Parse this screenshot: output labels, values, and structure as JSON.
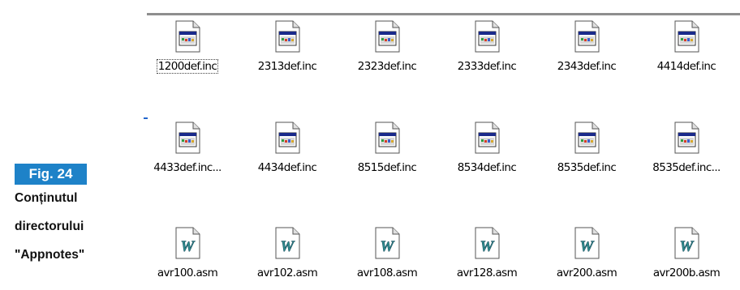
{
  "figure": {
    "badge": "Fig. 24",
    "caption": [
      "Conținutul",
      "directorului",
      "\"Appnotes\""
    ]
  },
  "files": [
    {
      "name": "1200def.inc",
      "icon": "inc-file-icon",
      "focused": true
    },
    {
      "name": "2313def.inc",
      "icon": "inc-file-icon"
    },
    {
      "name": "2323def.inc",
      "icon": "inc-file-icon"
    },
    {
      "name": "2333def.inc",
      "icon": "inc-file-icon"
    },
    {
      "name": "2343def.inc",
      "icon": "inc-file-icon"
    },
    {
      "name": "4414def.inc",
      "icon": "inc-file-icon"
    },
    {
      "name": "4433def.inc...",
      "icon": "inc-file-icon"
    },
    {
      "name": "4434def.inc",
      "icon": "inc-file-icon"
    },
    {
      "name": "8515def.inc",
      "icon": "inc-file-icon"
    },
    {
      "name": "8534def.inc",
      "icon": "inc-file-icon"
    },
    {
      "name": "8535def.inc",
      "icon": "inc-file-icon"
    },
    {
      "name": "8535def.inc...",
      "icon": "inc-file-icon"
    },
    {
      "name": "avr100.asm",
      "icon": "wordpad-document-icon"
    },
    {
      "name": "avr102.asm",
      "icon": "wordpad-document-icon"
    },
    {
      "name": "avr108.asm",
      "icon": "wordpad-document-icon"
    },
    {
      "name": "avr128.asm",
      "icon": "wordpad-document-icon"
    },
    {
      "name": "avr200.asm",
      "icon": "wordpad-document-icon"
    },
    {
      "name": "avr200b.asm",
      "icon": "wordpad-document-icon"
    }
  ],
  "colors": {
    "badge": "#1e82c8",
    "window_border": "#8e8e8e",
    "wordpad_w": "#2f8f8f"
  }
}
